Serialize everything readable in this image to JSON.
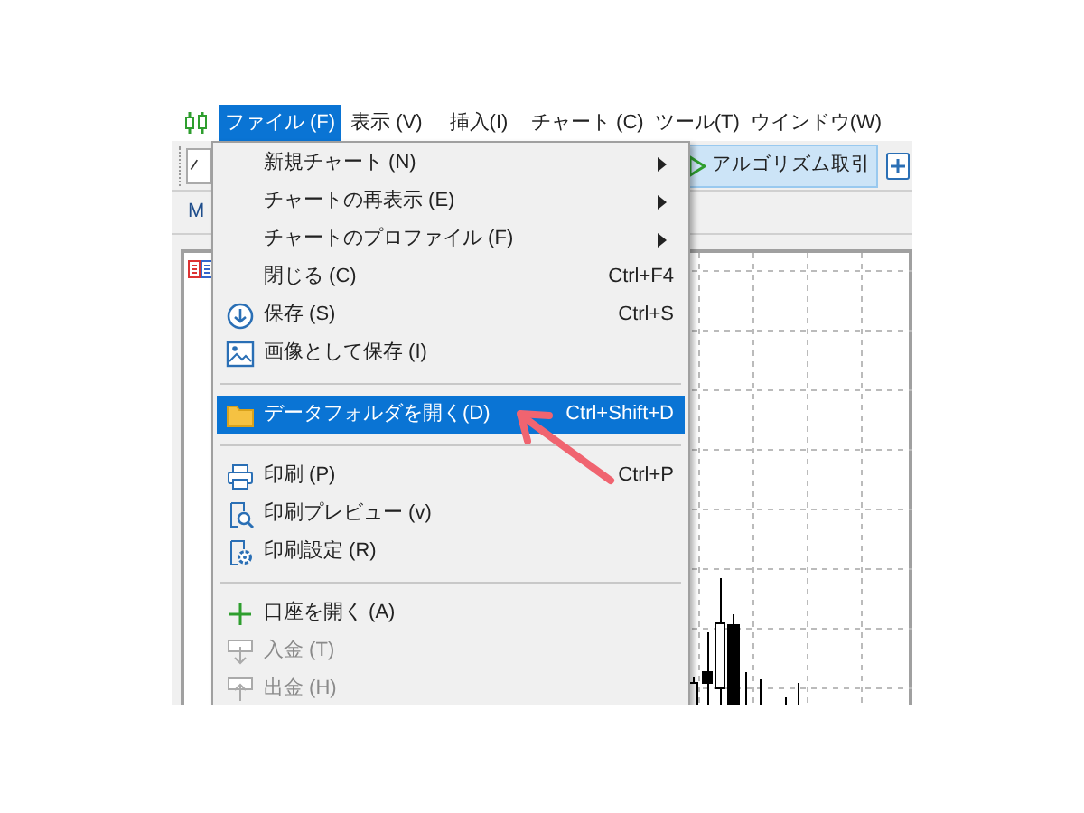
{
  "menu_bar": [
    {
      "label": "ファイル (F)",
      "selected": true
    },
    {
      "label": "表示 (V)",
      "selected": false
    },
    {
      "label": "挿入(I)",
      "selected": false
    },
    {
      "label": "チャート (C)",
      "selected": false
    },
    {
      "label": "ツール(T)",
      "selected": false
    },
    {
      "label": "ウインドウ(W)",
      "selected": false
    }
  ],
  "toolbar": {
    "algo_trading": "アルゴリズム取引"
  },
  "tab_label": "M",
  "file_menu": [
    {
      "kind": "item",
      "label": "新規チャート (N)",
      "submenu": true,
      "disabled": false,
      "selected": false
    },
    {
      "kind": "item",
      "label": "チャートの再表示 (E)",
      "submenu": true,
      "disabled": false,
      "selected": false
    },
    {
      "kind": "item",
      "label": "チャートのプロファイル (F)",
      "submenu": true,
      "disabled": false,
      "selected": false
    },
    {
      "kind": "item",
      "label": "閉じる (C)",
      "shortcut": "Ctrl+F4",
      "disabled": false,
      "selected": false
    },
    {
      "kind": "item",
      "label": "保存 (S)",
      "shortcut": "Ctrl+S",
      "disabled": false,
      "selected": false
    },
    {
      "kind": "item",
      "label": "画像として保存 (I)",
      "disabled": false,
      "selected": false
    },
    {
      "kind": "separator"
    },
    {
      "kind": "item",
      "label": "データフォルダを開く(D)",
      "shortcut": "Ctrl+Shift+D",
      "disabled": false,
      "selected": true
    },
    {
      "kind": "separator"
    },
    {
      "kind": "item",
      "label": "印刷 (P)",
      "shortcut": "Ctrl+P",
      "disabled": false,
      "selected": false
    },
    {
      "kind": "item",
      "label": "印刷プレビュー (v)",
      "disabled": false,
      "selected": false
    },
    {
      "kind": "item",
      "label": "印刷設定 (R)",
      "disabled": false,
      "selected": false
    },
    {
      "kind": "separator"
    },
    {
      "kind": "item",
      "label": "口座を開く (A)",
      "disabled": false,
      "selected": false
    },
    {
      "kind": "item",
      "label": "入金 (T)",
      "disabled": true,
      "selected": false
    },
    {
      "kind": "item",
      "label": "出金 (H)",
      "disabled": true,
      "selected": false
    }
  ]
}
